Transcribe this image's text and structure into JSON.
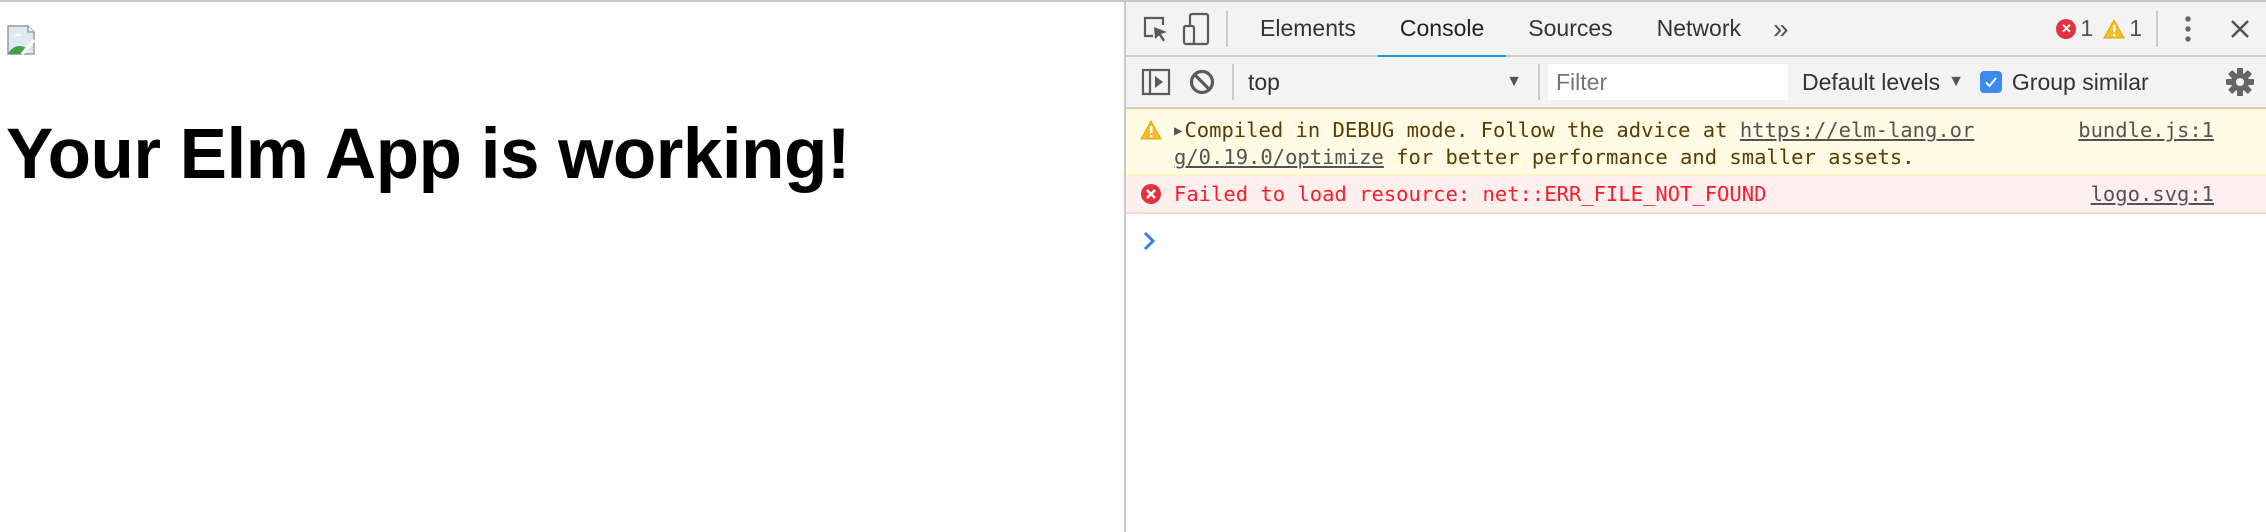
{
  "page": {
    "broken_image_icon": "broken-image-icon",
    "heading": "Your Elm App is working!"
  },
  "devtools": {
    "toolbar": {
      "inspect_icon": "element-picker-icon",
      "device_icon": "device-toolbar-icon",
      "tabs": [
        {
          "label": "Elements",
          "active": false
        },
        {
          "label": "Console",
          "active": true
        },
        {
          "label": "Sources",
          "active": false
        },
        {
          "label": "Network",
          "active": false
        }
      ],
      "more_tabs": "»",
      "error_count": "1",
      "warning_count": "1"
    },
    "console_toolbar": {
      "context": "top",
      "filter_placeholder": "Filter",
      "levels": "Default levels",
      "group_similar_label": "Group similar",
      "group_similar_checked": true
    },
    "messages": [
      {
        "level": "warning",
        "text_prefix": "Compiled in DEBUG mode. Follow the advice at ",
        "link_line1": "https://elm-lang.or",
        "link_line2": "g/0.19.0/optimize",
        "text_suffix": " for better performance and smaller assets.",
        "source": "bundle.js:1"
      },
      {
        "level": "error",
        "text": "Failed to load resource: net::ERR_FILE_NOT_FOUND",
        "source": "logo.svg:1"
      }
    ],
    "colors": {
      "tab_active_underline": "#1a9bde",
      "error_text": "#fe1c2b",
      "warning_bg": "#fffbe5",
      "error_bg": "#fff0f0",
      "checkbox": "#3b8aef",
      "prompt": "#3b7ded"
    }
  }
}
